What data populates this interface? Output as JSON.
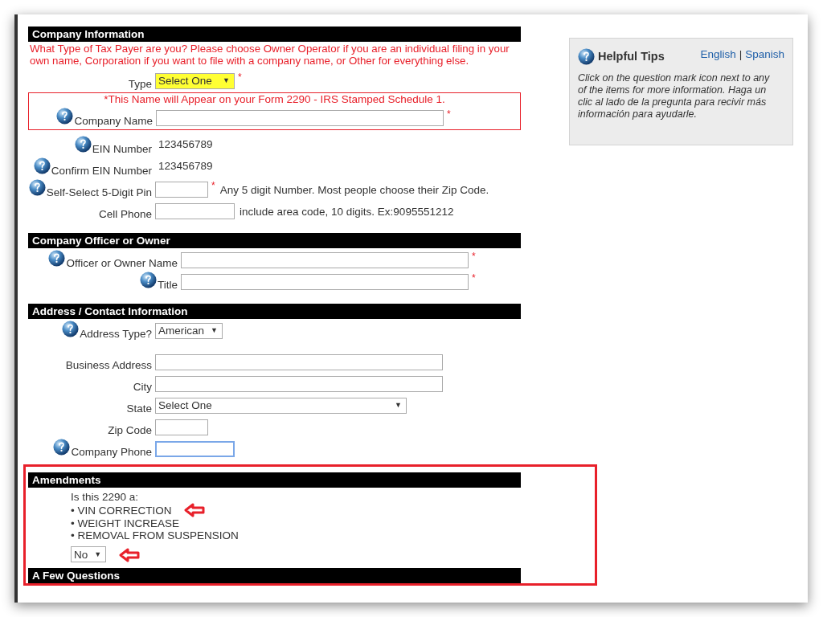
{
  "sections": [
    {
      "title": "Company Information",
      "annotated": false,
      "intro": "What Type of Tax Payer are you? Please choose Owner Operator if you are an individual filing in your own name, Corporation if you want to file with a company name, or Other for everything else.",
      "rows": [
        {
          "kind": "medium-select",
          "label": "Type",
          "help": false,
          "value": "Select One",
          "caret": "▼",
          "highlighted": true,
          "required": "*"
        },
        {
          "kind": "notice",
          "text": "*This Name will Appear on your Form 2290 - IRS Stamped Schedule 1.",
          "rows": [
            {
              "kind": "long-input",
              "label": "Company Name",
              "help": true,
              "required": "*"
            }
          ]
        },
        {
          "kind": "static",
          "label": "EIN Number",
          "help": true,
          "value": "123456789"
        },
        {
          "kind": "static",
          "label": "Confirm EIN Number",
          "help": true,
          "value": "123456789"
        },
        {
          "kind": "short-input",
          "label": "Self-Select 5-Digit Pin",
          "help": true,
          "required": "*",
          "hint": "Any 5 digit Number. Most people choose their Zip Code."
        },
        {
          "kind": "medium-input",
          "label": "Cell Phone",
          "help": false,
          "hint": "include area code, 10 digits. Ex:9095551212"
        }
      ]
    },
    {
      "title": "Company Officer or Owner",
      "annotated": false,
      "rows": [
        {
          "kind": "long-input",
          "label": "Officer or Owner Name",
          "help": true,
          "required": "*"
        },
        {
          "kind": "long-input",
          "label": "Title",
          "help": true,
          "required": "*"
        }
      ]
    },
    {
      "title": "Address / Contact Information",
      "annotated": false,
      "rows": [
        {
          "kind": "auto-select",
          "label": "Address Type?",
          "help": true,
          "value": "American",
          "caret": "▼",
          "highlighted": false
        },
        {
          "kind": "spacer"
        },
        {
          "kind": "long-input",
          "label": "Business Address",
          "help": false
        },
        {
          "kind": "long-input",
          "label": "City",
          "help": false
        },
        {
          "kind": "wide-select",
          "label": "State",
          "help": false,
          "value": "Select One",
          "caret": "▼",
          "highlighted": false
        },
        {
          "kind": "short-input",
          "label": "Zip Code",
          "help": false
        },
        {
          "kind": "medium-input",
          "label": "Company Phone",
          "help": true,
          "focused": true
        }
      ]
    },
    {
      "title": "Amendments",
      "annotated": true,
      "lines": [
        {
          "text": "Is this 2290 a:",
          "arrow": false
        },
        {
          "text": "• VIN CORRECTION",
          "arrow": true
        },
        {
          "text": "• WEIGHT INCREASE",
          "arrow": false
        },
        {
          "text": "• REMOVAL FROM SUSPENSION",
          "arrow": false
        }
      ],
      "select": {
        "value": "No",
        "caret": "▼",
        "arrow": true
      }
    },
    {
      "title": "A Few Questions",
      "annotated": true
    }
  ],
  "tips": {
    "title": "Helpful Tips",
    "languages": [
      {
        "label": "English",
        "selected": false
      },
      {
        "label": "Spanish",
        "selected": false
      }
    ],
    "separator": "|",
    "body": "Click on the question mark icon next to any of the items for more information. Haga un clic al lado de la pregunta para recivir más información para ayudarle."
  }
}
